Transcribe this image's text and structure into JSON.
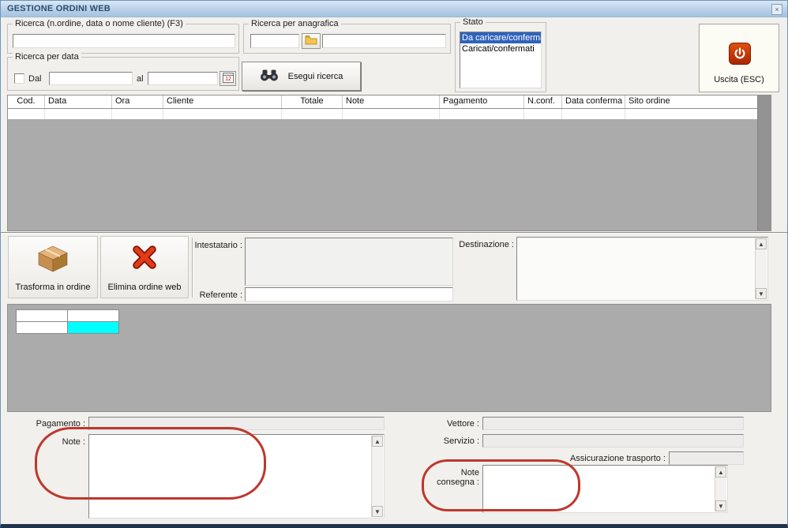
{
  "titlebar": {
    "title": "GESTIONE ORDINI WEB"
  },
  "icons": {
    "close": "×",
    "scroll_up": "▲",
    "scroll_down": "▼",
    "binoculars_icon": "binoculars",
    "folder_icon": "open-folder",
    "calendar_icon": "calendar",
    "package_icon": "package-box",
    "red_x_icon": "red-x",
    "power_icon": "power"
  },
  "search": {
    "order_label": "Ricerca (n.ordine, data o nome cliente) (F3)",
    "anagrafica_label": "Ricerca per anagrafica",
    "date_label": "Ricerca per data",
    "dal_label": "Dal",
    "al_label": "al",
    "esegui_label": "Esegui ricerca",
    "stato_label": "Stato",
    "stato_options": [
      "Da caricare/confermare",
      "Caricati/confermati"
    ],
    "stato_selected_index": 0,
    "uscita_label": "Uscita (ESC)"
  },
  "values": {
    "order_search": "",
    "anagrafica_code": "",
    "anagrafica_name": "",
    "date_from": "",
    "date_to": "",
    "dal_checked": false,
    "referente": "",
    "pagamento": "",
    "vettore": "",
    "servizio": "",
    "assicurazione_trasporto": "",
    "intestatario": "",
    "destinazione": "",
    "note": "",
    "note_consegna": ""
  },
  "table": {
    "columns": [
      "Cod.",
      "Data",
      "Ora",
      "Cliente",
      "Totale",
      "Note",
      "Pagamento",
      "N.conf.",
      "Data conferma",
      "Sito ordine"
    ],
    "rows": []
  },
  "actions": {
    "trasforma_label": "Trasforma in ordine",
    "elimina_label": "Elimina ordine web"
  },
  "fields": {
    "intestatario_label": "Intestatario :",
    "referente_label": "Referente :",
    "destinazione_label": "Destinazione :"
  },
  "detail_grid": {
    "rows": [
      [
        "",
        ""
      ],
      [
        "",
        ""
      ]
    ],
    "selected_cell": {
      "row": 1,
      "col": 1,
      "color": "#00ffff"
    }
  },
  "footer": {
    "pagamento_label": "Pagamento :",
    "note_label": "Note :",
    "vettore_label": "Vettore :",
    "servizio_label": "Servizio :",
    "assicurazione_label": "Assicurazione trasporto :",
    "note_consegna_line1": "Note",
    "note_consegna_line2": "consegna :"
  },
  "colors": {
    "selection_blue": "#2e63bb",
    "grid_highlight_cyan": "#00ffff",
    "annotation_red": "#bd382e",
    "exit_icon_red": "#cf3a0e",
    "table_gray": "#ababab"
  }
}
